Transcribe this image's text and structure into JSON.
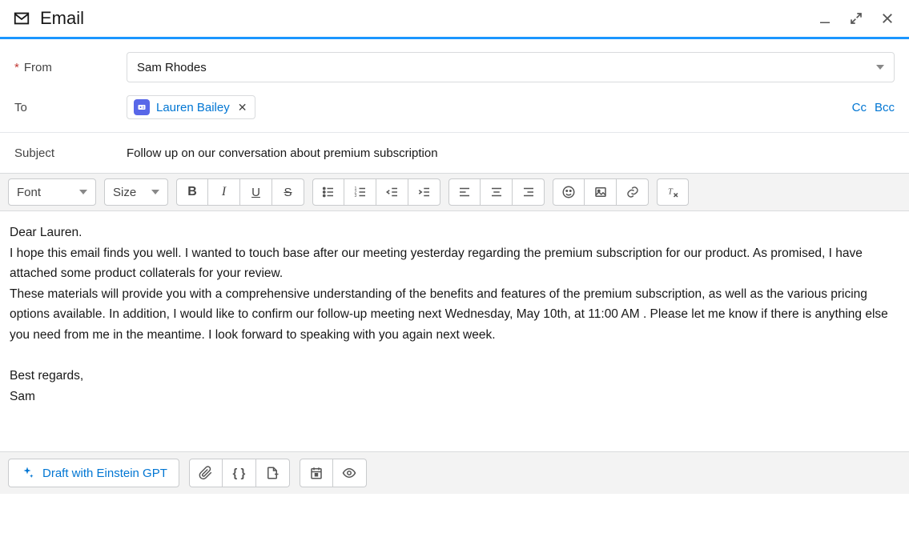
{
  "window": {
    "title": "Email"
  },
  "fields": {
    "from_label": "From",
    "from_value": "Sam Rhodes",
    "to_label": "To",
    "to_recipient": "Lauren Bailey",
    "cc_label": "Cc",
    "bcc_label": "Bcc",
    "subject_label": "Subject",
    "subject_value": "Follow up on our conversation about premium subscription"
  },
  "toolbar": {
    "font_label": "Font",
    "size_label": "Size"
  },
  "body": {
    "greeting": "Dear Lauren.",
    "p1": "I hope this email finds you well. I wanted to touch base after our meeting yesterday regarding the premium subscription for our product. As promised, I have attached some product collaterals for your review.",
    "p2": "These materials will provide you with a comprehensive understanding of the benefits and features of the premium subscription, as well as the various pricing options available. In addition, I would like to confirm our follow-up meeting next Wednesday, May 10th, at 11:00 AM . Please let me know if there is anything else you need from me in the meantime. I look forward to speaking with you again next week.",
    "closing": "Best regards,",
    "signature": "Sam"
  },
  "footer": {
    "draft_label": "Draft with Einstein GPT"
  }
}
